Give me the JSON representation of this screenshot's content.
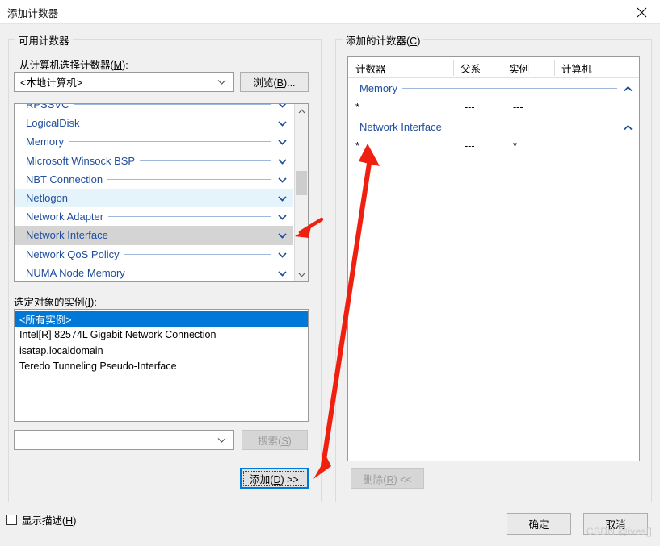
{
  "window": {
    "title": "添加计数器",
    "close_icon": "close-icon"
  },
  "available_group": {
    "legend": "可用计数器",
    "computer_label": "从计算机选择计数器(M):",
    "computer_value": "<本地计算机>",
    "browse_button": "浏览(B)...",
    "counters": [
      {
        "name": "RPSSVC",
        "state": "normal",
        "partial": true
      },
      {
        "name": "LogicalDisk",
        "state": "normal"
      },
      {
        "name": "Memory",
        "state": "normal"
      },
      {
        "name": "Microsoft Winsock BSP",
        "state": "normal"
      },
      {
        "name": "NBT Connection",
        "state": "normal"
      },
      {
        "name": "Netlogon",
        "state": "hover"
      },
      {
        "name": "Network Adapter",
        "state": "normal"
      },
      {
        "name": "Network Interface",
        "state": "selected"
      },
      {
        "name": "Network QoS Policy",
        "state": "normal"
      },
      {
        "name": "NUMA Node Memory",
        "state": "normal"
      }
    ],
    "instances_label": "选定对象的实例(I):",
    "instances": [
      {
        "name": "<所有实例>",
        "selected": true
      },
      {
        "name": "Intel[R] 82574L Gigabit Network Connection",
        "selected": false
      },
      {
        "name": "isatap.localdomain",
        "selected": false
      },
      {
        "name": "Teredo Tunneling Pseudo-Interface",
        "selected": false
      }
    ],
    "search_value": "",
    "search_button": "搜索(S)",
    "search_button_enabled": false,
    "add_button": "添加(D) >>",
    "add_button_focused": true
  },
  "added_group": {
    "legend": "添加的计数器(C)",
    "columns": [
      "计数器",
      "父系",
      "实例",
      "计算机"
    ],
    "rows": [
      {
        "type": "group",
        "counter": "Memory",
        "collapse_icon": "chevron-up-icon"
      },
      {
        "type": "data",
        "counter": "*",
        "parent": "---",
        "instance": "---",
        "computer": ""
      },
      {
        "type": "group",
        "counter": "Network Interface",
        "collapse_icon": "chevron-up-icon"
      },
      {
        "type": "data",
        "counter": "*",
        "parent": "---",
        "instance": "*",
        "computer": ""
      }
    ],
    "remove_button": "删除(R) <<",
    "remove_button_enabled": false
  },
  "footer": {
    "show_description_label": "显示描述(H)",
    "show_description_checked": false,
    "ok_button": "确定",
    "cancel_button": "取消"
  },
  "watermark": "CSDN @ives[]",
  "colors": {
    "accent": "#0078d7",
    "counter_blue": "#1f4e9c",
    "annotation_red": "#f02010",
    "selection_gray": "#d4d4d4",
    "hover_blue": "#e5f3fb"
  }
}
